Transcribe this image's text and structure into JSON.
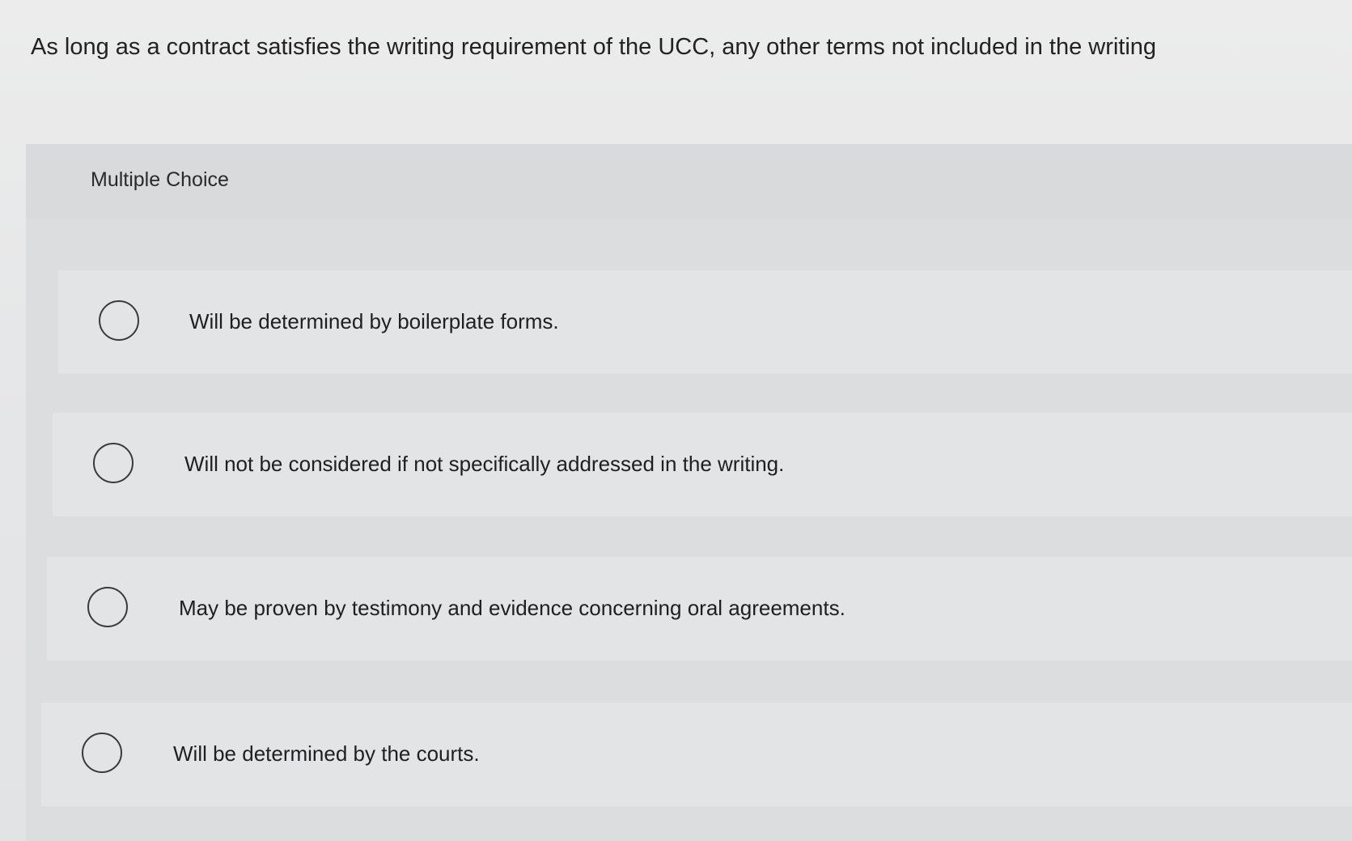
{
  "question": {
    "text": "As long as a contract satisfies the writing requirement of the UCC, any other terms not included in the writing"
  },
  "multiple_choice": {
    "label": "Multiple Choice",
    "options": [
      {
        "text": "Will be determined by boilerplate forms."
      },
      {
        "text": "Will not be considered if not specifically addressed in the writing."
      },
      {
        "text": "May be proven by testimony and evidence concerning oral agreements."
      },
      {
        "text": "Will be determined by the courts."
      }
    ]
  }
}
